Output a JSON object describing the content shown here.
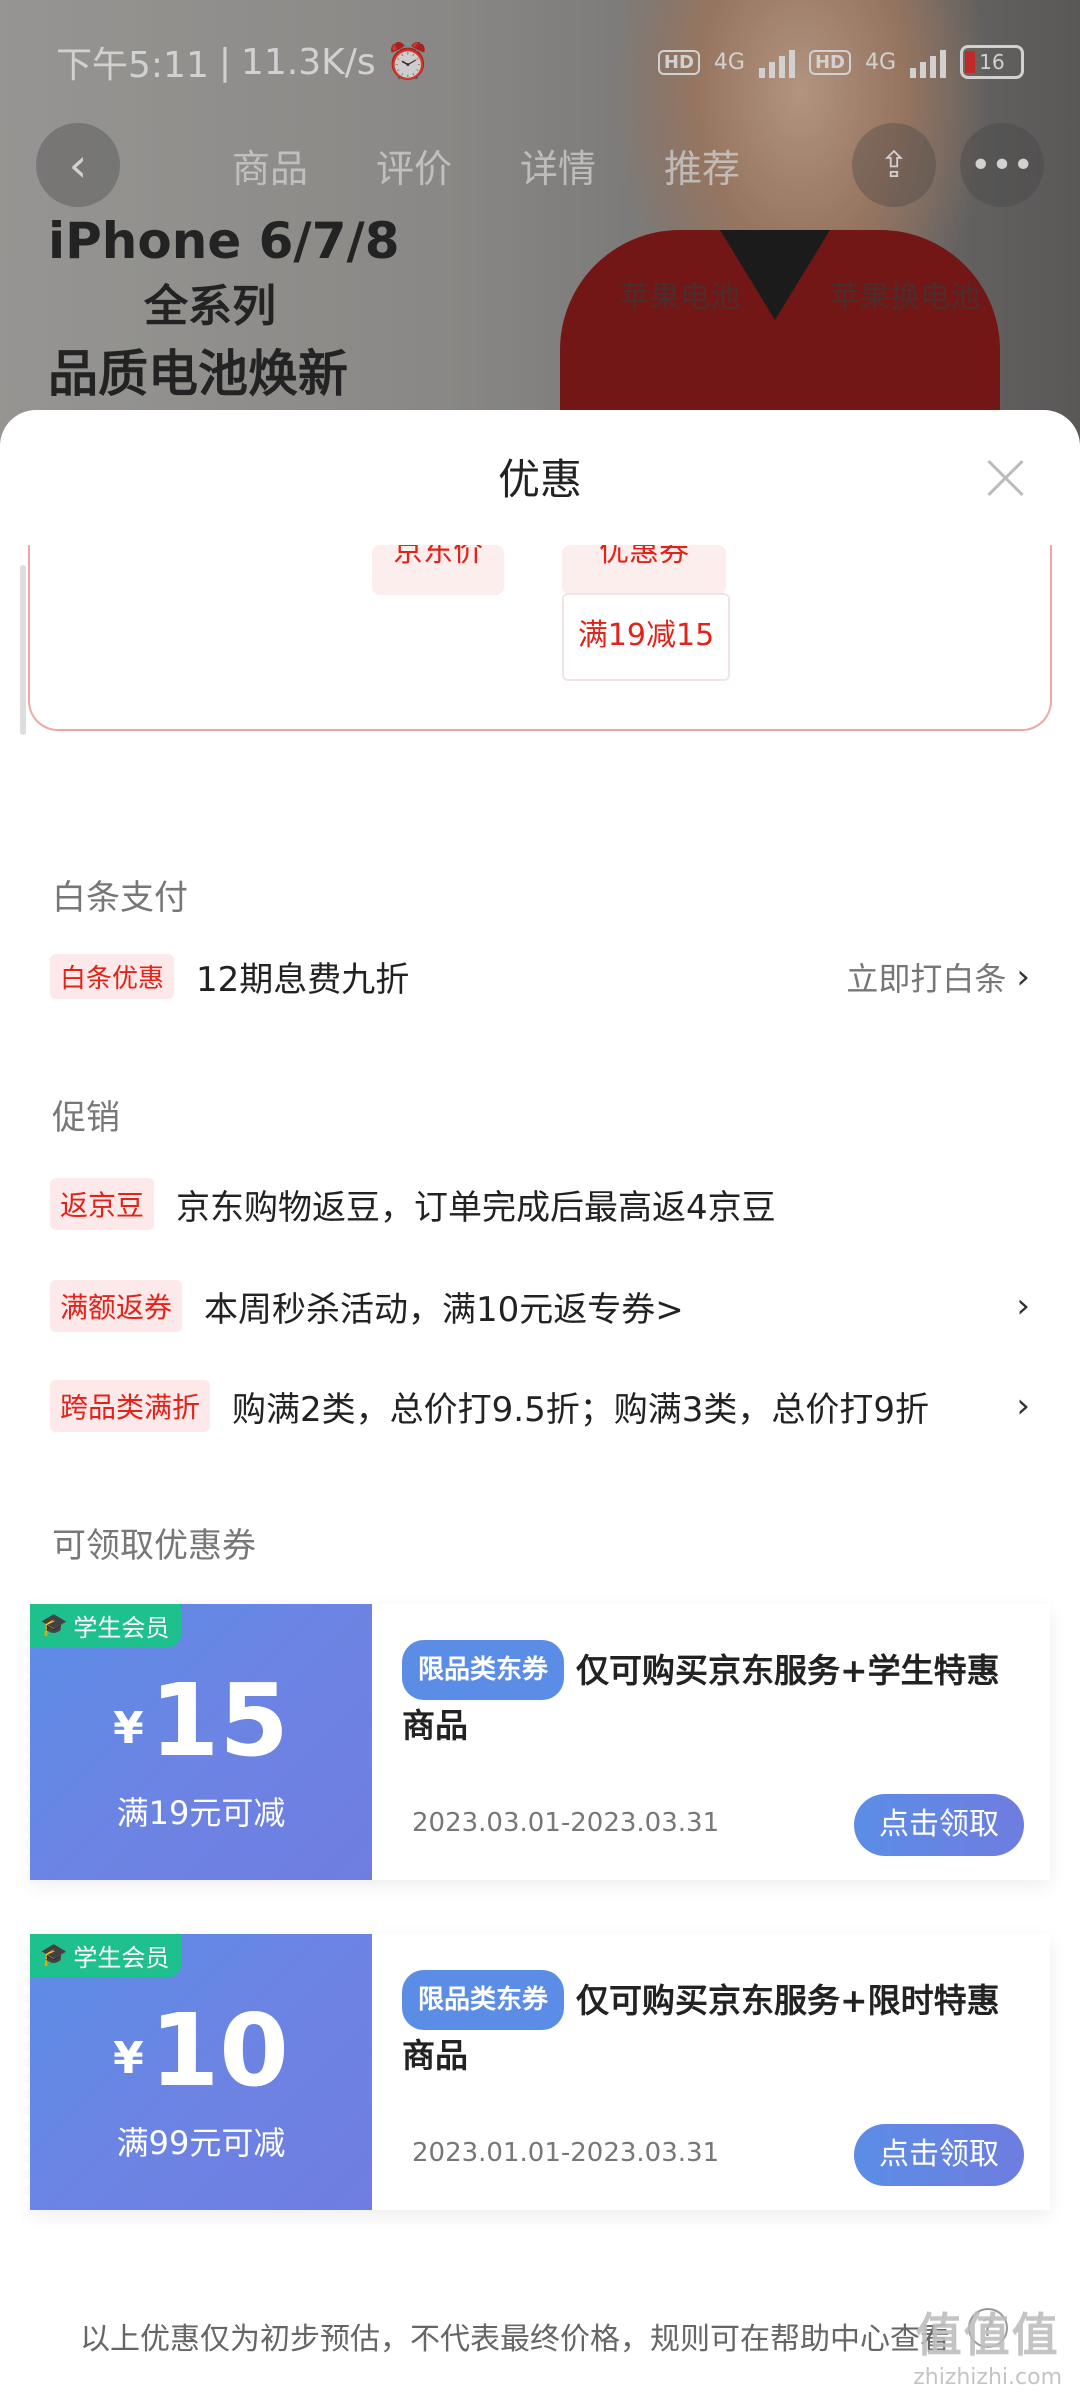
{
  "status_bar": {
    "time": "下午5:11",
    "speed": "11.3K/s",
    "hd1": "HD",
    "net1": "4G",
    "hd2": "HD",
    "net2": "4G",
    "battery": "16"
  },
  "product_nav": {
    "tabs": [
      "商品",
      "评价",
      "详情",
      "推荐"
    ],
    "search_hints": [
      "苹果电池",
      "苹果换电池"
    ]
  },
  "banner": {
    "line1": "iPhone 6/7/8",
    "line2": "全系列",
    "line3": "品质电池焕新"
  },
  "sheet": {
    "title": "优惠"
  },
  "price_card": {
    "tag1": "京东价",
    "tag2": "优惠券",
    "coupon_rule": "满19减15"
  },
  "baitiao": {
    "section_label": "白条支付",
    "tag": "白条优惠",
    "text": "12期息费九折",
    "action": "立即打白条"
  },
  "promotions": {
    "section_label": "促销",
    "items": [
      {
        "tag": "返京豆",
        "text": "京东购物返豆，订单完成后最高返4京豆",
        "has_arrow": false
      },
      {
        "tag": "满额返券",
        "text": "本周秒杀活动，满10元返专券>",
        "has_arrow": true
      },
      {
        "tag": "跨品类满折",
        "text": "购满2类，总价打9.5折；购满3类，总价打9折",
        "has_arrow": true
      }
    ]
  },
  "coupons": {
    "section_label": "可领取优惠券",
    "items": [
      {
        "badge": "学生会员",
        "currency": "¥",
        "amount": "15",
        "condition": "满19元可减",
        "type_tag": "限品类东券",
        "desc": "仅可购买京东服务+学生特惠商品",
        "date_range": "2023.03.01-2023.03.31",
        "button": "点击领取"
      },
      {
        "badge": "学生会员",
        "currency": "¥",
        "amount": "10",
        "condition": "满99元可减",
        "type_tag": "限品类东券",
        "desc": "仅可购买京东服务+限时特惠商品",
        "date_range": "2023.01.01-2023.03.31",
        "button": "点击领取"
      }
    ]
  },
  "footer": {
    "note": "以上优惠仅为初步预估，不代表最终价格，规则可在帮助中心查看",
    "watermark": "值值值",
    "watermark_url": "zhizhizhi.com"
  },
  "colors": {
    "brand_red": "#e2231a",
    "coupon_blue": "#5b8de6",
    "badge_green": "#1ec08e"
  }
}
